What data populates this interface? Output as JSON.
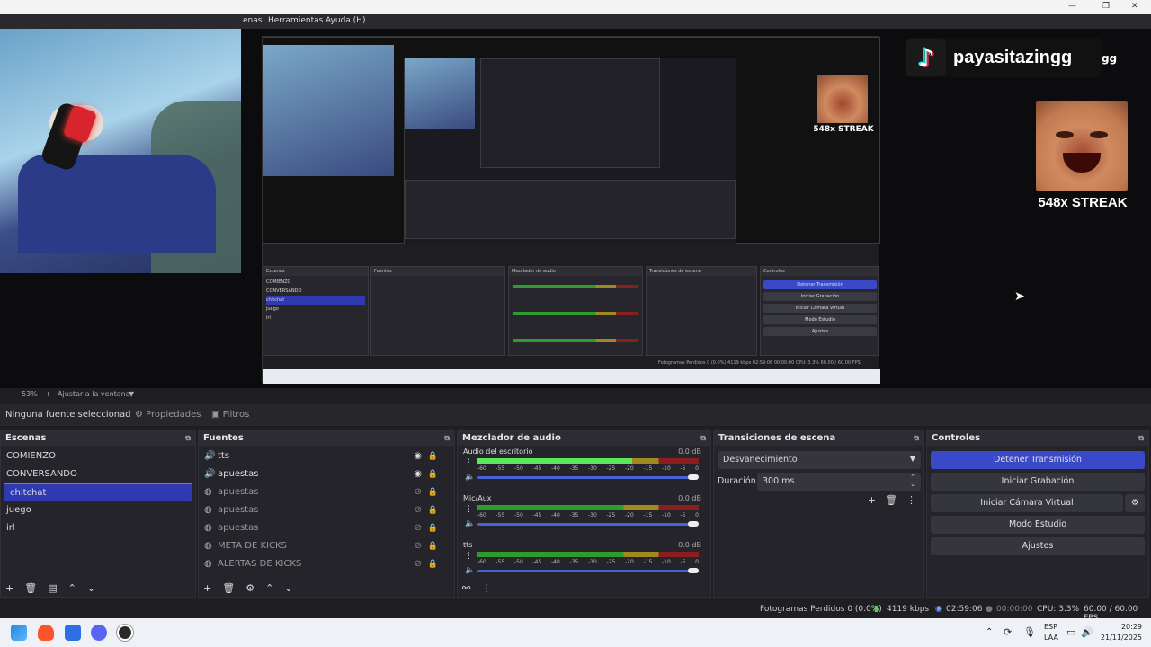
{
  "menubar": {
    "items": [
      "enas",
      "Herramientas",
      "Ayuda (H)"
    ]
  },
  "overlay": {
    "channel": "payasitazingg",
    "streak": "548x STREAK"
  },
  "nested": {
    "controls": [
      "Detener Transmisión",
      "Iniciar Grabación",
      "Iniciar Cámara Virtual",
      "Modo Estudio",
      "Ajustes"
    ],
    "scenes": [
      "COMIENZO",
      "CONVERSANDO",
      "chitchat",
      "juego",
      "irl"
    ],
    "headers": [
      "Escenas",
      "Fuentes",
      "Mezclador de audio",
      "Transiciones de escena",
      "Controles"
    ],
    "status": "Fotogramas Perdidos 0 (0.0%)   4119 kbps   02:59:06   00:00:00   CPU: 3.3%   60.00 / 60.00 FPS"
  },
  "zoom": {
    "minus": "−",
    "value": "53%",
    "plus": "+",
    "fit": "Ajustar a la ventana",
    "caret": "▼"
  },
  "props": {
    "none": "Ninguna fuente seleccionad",
    "properties": "Propiedades",
    "filters": "Filtros"
  },
  "scenes": {
    "title": "Escenas",
    "items": [
      "COMIENZO",
      "CONVERSANDO",
      "chitchat",
      "juego",
      "irl"
    ],
    "selected": "chitchat"
  },
  "sources": {
    "title": "Fuentes",
    "items": [
      {
        "name": "tts",
        "icon": "speaker-icon",
        "visible": true
      },
      {
        "name": "apuestas",
        "icon": "speaker-icon",
        "visible": true
      },
      {
        "name": "apuestas",
        "icon": "browser-icon",
        "visible": false
      },
      {
        "name": "apuestas",
        "icon": "browser-icon",
        "visible": false
      },
      {
        "name": "apuestas",
        "icon": "browser-icon",
        "visible": false
      },
      {
        "name": "META DE KICKS",
        "icon": "browser-icon",
        "visible": false
      },
      {
        "name": "ALERTAS DE KICKS",
        "icon": "browser-icon",
        "visible": false
      }
    ]
  },
  "mixer": {
    "title": "Mezclador de audio",
    "ticks": [
      "-60",
      "-55",
      "-50",
      "-45",
      "-40",
      "-35",
      "-30",
      "-25",
      "-20",
      "-15",
      "-10",
      "-5",
      "0"
    ],
    "channels": [
      {
        "name": "Audio del escritorio",
        "db": "0.0 dB",
        "level": 0.7
      },
      {
        "name": "Mic/Aux",
        "db": "0.0 dB",
        "level": 0.0
      },
      {
        "name": "tts",
        "db": "0.0 dB",
        "level": 0.0
      }
    ]
  },
  "transitions": {
    "title": "Transiciones de escena",
    "selected": "Desvanecimiento",
    "duration_label": "Duración",
    "duration_value": "300 ms"
  },
  "controls": {
    "title": "Controles",
    "stop_stream": "Detener Transmisión",
    "start_record": "Iniciar Grabación",
    "start_vcam": "Iniciar Cámara Virtual",
    "studio_mode": "Modo Estudio",
    "settings": "Ajustes"
  },
  "status": {
    "dropped": "Fotogramas Perdidos 0 (0.0%)",
    "bitrate": "4119 kbps",
    "stream_time": "02:59:06",
    "record_time": "00:00:00",
    "cpu": "CPU: 3.3%",
    "fps": "60.00 / 60.00 FPS"
  },
  "taskbar": {
    "lang": "ESP",
    "layout": "LAA",
    "time": "20:29",
    "date": "21/11/2025"
  },
  "colors": {
    "accent": "#3a49c8",
    "selected": "#2f3ab0",
    "meter_green": "#2e9b2e",
    "meter_yellow": "#a08a20",
    "meter_red": "#8a1e1e"
  }
}
